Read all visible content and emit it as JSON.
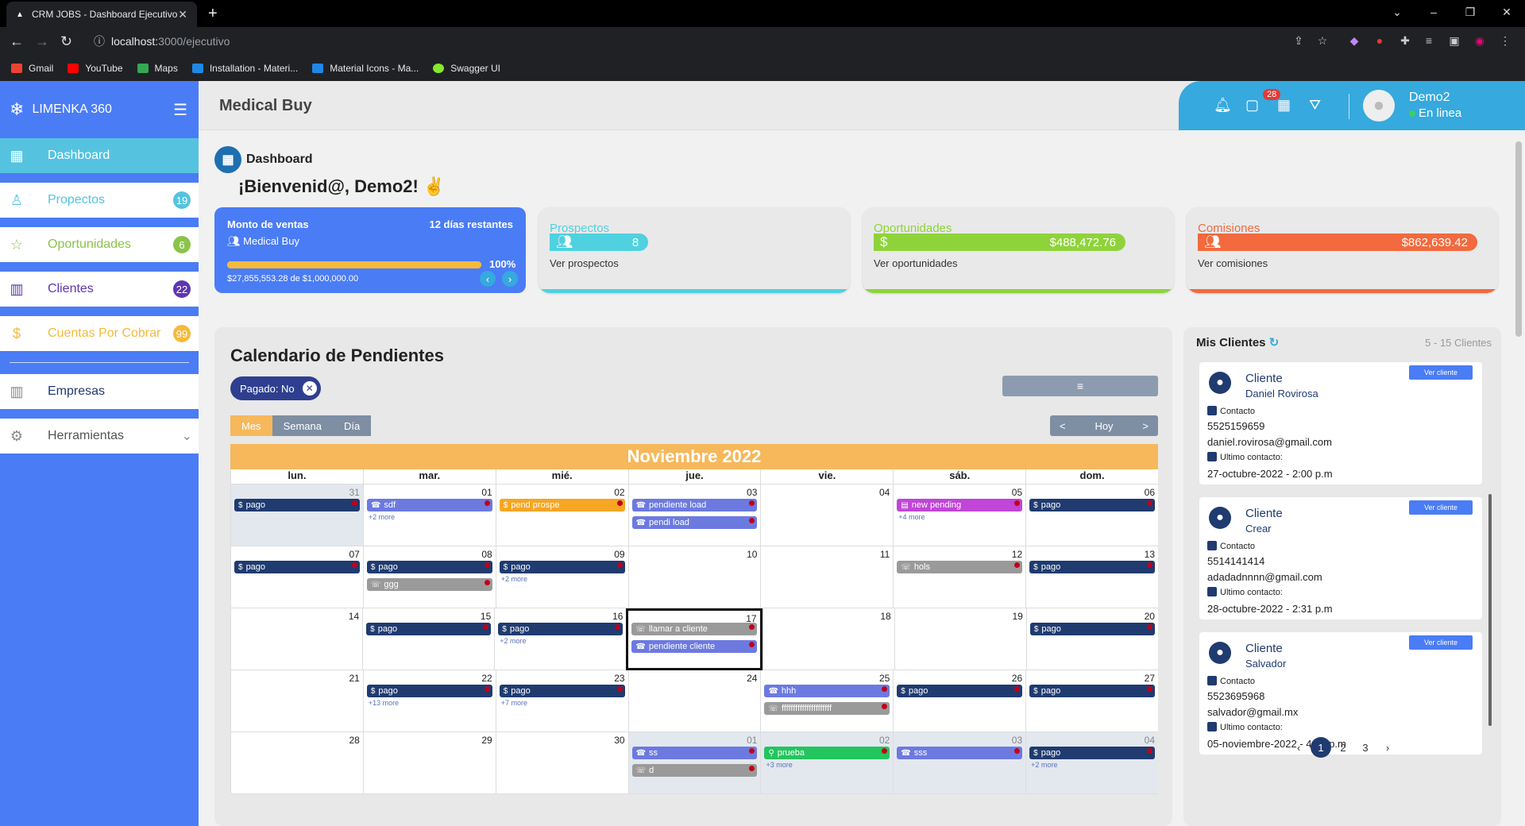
{
  "browser": {
    "tab_title": "CRM JOBS - Dashboard Ejecutivo",
    "url_host": "localhost:",
    "url_path": "3000/ejecutivo",
    "bookmarks": [
      "Gmail",
      "YouTube",
      "Maps",
      "Installation - Materi...",
      "Material Icons - Ma...",
      "Swagger UI"
    ]
  },
  "sidebar": {
    "brand": "LIMENKA 360",
    "items": [
      {
        "label": "Dashboard",
        "badge": "",
        "color": "#ffffff"
      },
      {
        "label": "Propectos",
        "badge": "19",
        "color": "#55c3e0"
      },
      {
        "label": "Oportunidades",
        "badge": "6",
        "color": "#8bc34a"
      },
      {
        "label": "Clientes",
        "badge": "22",
        "color": "#5e35b1"
      },
      {
        "label": "Cuentas Por Cobrar",
        "badge": "99",
        "color": "#f6b93b"
      }
    ],
    "empresas": "Empresas",
    "herramientas": "Herramientas"
  },
  "topbar": {
    "title": "Medical Buy",
    "notif_count": "28",
    "user_name": "Demo2",
    "user_status": "En linea"
  },
  "dashboard": {
    "title": "Dashboard",
    "welcome": "¡Bienvenid@, Demo2! ✌"
  },
  "sales_card": {
    "title": "Monto de ventas",
    "days_left": "12 días restantes",
    "company": "Medical Buy",
    "percent_label": "100%",
    "progress": 1.0,
    "amount": "$27,855,553.28 de $1,000,000.00"
  },
  "kpis": [
    {
      "title": "Prospectos",
      "value": "8",
      "link": "Ver prospectos",
      "color": "#4fd1e0",
      "fill": 0.22
    },
    {
      "title": "Oportunidades",
      "value": "$488,472.76",
      "link": "Ver oportunidades",
      "color": "#8fd33a",
      "fill": 0.88
    },
    {
      "title": "Comisiones",
      "value": "$862,639.42",
      "link": "Ver comisiones",
      "color": "#f26a3d",
      "fill": 1.0
    }
  ],
  "calendar": {
    "title": "Calendario de Pendientes",
    "chip": "Pagado: No",
    "views": [
      "Mes",
      "Semana",
      "Día"
    ],
    "prev": "<",
    "today": "Hoy",
    "next": ">",
    "month": "Noviembre 2022",
    "dow": [
      "lun.",
      "mar.",
      "mié.",
      "jue.",
      "vie.",
      "sáb.",
      "dom."
    ],
    "weeks": [
      [
        {
          "n": "31",
          "other": true,
          "ev": [
            {
              "t": "pago",
              "c": "#1f3b70",
              "i": "$"
            }
          ],
          "more": ""
        },
        {
          "n": "01",
          "ev": [
            {
              "t": "sdf",
              "c": "#6c7ae0",
              "i": "☎"
            }
          ],
          "more": "+2 more"
        },
        {
          "n": "02",
          "ev": [
            {
              "t": "pend prospe",
              "c": "#f6a623",
              "i": "$"
            }
          ],
          "more": ""
        },
        {
          "n": "03",
          "ev": [
            {
              "t": "pendiente load",
              "c": "#6c7ae0",
              "i": "☎"
            },
            {
              "t": "pendi load",
              "c": "#6c7ae0",
              "i": "☎"
            }
          ],
          "more": ""
        },
        {
          "n": "04",
          "ev": [],
          "more": ""
        },
        {
          "n": "05",
          "ev": [
            {
              "t": "new pending",
              "c": "#c045d8",
              "i": "▤"
            }
          ],
          "more": "+4 more"
        },
        {
          "n": "06",
          "ev": [
            {
              "t": "pago",
              "c": "#1f3b70",
              "i": "$"
            }
          ],
          "more": ""
        }
      ],
      [
        {
          "n": "07",
          "ev": [
            {
              "t": "pago",
              "c": "#1f3b70",
              "i": "$"
            }
          ],
          "more": ""
        },
        {
          "n": "08",
          "ev": [
            {
              "t": "pago",
              "c": "#1f3b70",
              "i": "$"
            },
            {
              "t": "ggg",
              "c": "#9a9a9a",
              "i": "☏"
            }
          ],
          "more": ""
        },
        {
          "n": "09",
          "ev": [
            {
              "t": "pago",
              "c": "#1f3b70",
              "i": "$"
            }
          ],
          "more": "+2 more"
        },
        {
          "n": "10",
          "ev": [],
          "more": ""
        },
        {
          "n": "11",
          "ev": [],
          "more": ""
        },
        {
          "n": "12",
          "ev": [
            {
              "t": "hols",
              "c": "#9a9a9a",
              "i": "☏"
            }
          ],
          "more": ""
        },
        {
          "n": "13",
          "ev": [
            {
              "t": "pago",
              "c": "#1f3b70",
              "i": "$"
            }
          ],
          "more": ""
        }
      ],
      [
        {
          "n": "14",
          "ev": [],
          "more": ""
        },
        {
          "n": "15",
          "ev": [
            {
              "t": "pago",
              "c": "#1f3b70",
              "i": "$"
            }
          ],
          "more": ""
        },
        {
          "n": "16",
          "ev": [
            {
              "t": "pago",
              "c": "#1f3b70",
              "i": "$"
            }
          ],
          "more": "+2 more"
        },
        {
          "n": "17",
          "today": true,
          "ev": [
            {
              "t": "llamar a cliente",
              "c": "#9a9a9a",
              "i": "☏"
            },
            {
              "t": "pendiente cliente",
              "c": "#6c7ae0",
              "i": "☎"
            }
          ],
          "more": ""
        },
        {
          "n": "18",
          "ev": [],
          "more": ""
        },
        {
          "n": "19",
          "ev": [],
          "more": ""
        },
        {
          "n": "20",
          "ev": [
            {
              "t": "pago",
              "c": "#1f3b70",
              "i": "$"
            }
          ],
          "more": ""
        }
      ],
      [
        {
          "n": "21",
          "ev": [],
          "more": ""
        },
        {
          "n": "22",
          "ev": [
            {
              "t": "pago",
              "c": "#1f3b70",
              "i": "$"
            }
          ],
          "more": "+13 more"
        },
        {
          "n": "23",
          "ev": [
            {
              "t": "pago",
              "c": "#1f3b70",
              "i": "$"
            }
          ],
          "more": "+7 more"
        },
        {
          "n": "24",
          "ev": [],
          "more": ""
        },
        {
          "n": "25",
          "ev": [
            {
              "t": "hhh",
              "c": "#6c7ae0",
              "i": "☎"
            },
            {
              "t": "ffffffffffffffffffffff",
              "c": "#9a9a9a",
              "i": "☏"
            }
          ],
          "more": ""
        },
        {
          "n": "26",
          "ev": [
            {
              "t": "pago",
              "c": "#1f3b70",
              "i": "$"
            }
          ],
          "more": ""
        },
        {
          "n": "27",
          "ev": [
            {
              "t": "pago",
              "c": "#1f3b70",
              "i": "$"
            }
          ],
          "more": ""
        }
      ],
      [
        {
          "n": "28",
          "ev": [],
          "more": ""
        },
        {
          "n": "29",
          "ev": [],
          "more": ""
        },
        {
          "n": "30",
          "ev": [],
          "more": ""
        },
        {
          "n": "01",
          "other": true,
          "ev": [
            {
              "t": "ss",
              "c": "#6c7ae0",
              "i": "☎"
            },
            {
              "t": "d",
              "c": "#9a9a9a",
              "i": "☏"
            }
          ],
          "more": ""
        },
        {
          "n": "02",
          "other": true,
          "ev": [
            {
              "t": "prueba",
              "c": "#22c55e",
              "i": "⚲"
            }
          ],
          "more": "+3 more"
        },
        {
          "n": "03",
          "other": true,
          "ev": [
            {
              "t": "sss",
              "c": "#6c7ae0",
              "i": "☎"
            }
          ],
          "more": ""
        },
        {
          "n": "04",
          "other": true,
          "ev": [
            {
              "t": "pago",
              "c": "#1f3b70",
              "i": "$"
            }
          ],
          "more": "+2 more"
        }
      ]
    ]
  },
  "clients": {
    "title": "Mis Clientes",
    "count": "5 - 15 Clientes",
    "button": "Ver cliente",
    "label": "Cliente",
    "contact_label": "Contacto",
    "last_label": "Ultimo contacto:",
    "items": [
      {
        "name": "Daniel Rovirosa",
        "phone": "5525159659",
        "email": "daniel.rovirosa@gmail.com",
        "last": "27-octubre-2022 - 2:00 p.m"
      },
      {
        "name": "Crear",
        "phone": "5514141414",
        "email": "adadadnnnn@gmail.com",
        "last": "28-octubre-2022 - 2:31 p.m"
      },
      {
        "name": "Salvador",
        "phone": "5523695968",
        "email": "salvador@gmail.mx",
        "last": "05-noviembre-2022 - 4:22 p.m"
      }
    ],
    "pages": [
      "1",
      "2",
      "3"
    ],
    "current_page": "1"
  }
}
